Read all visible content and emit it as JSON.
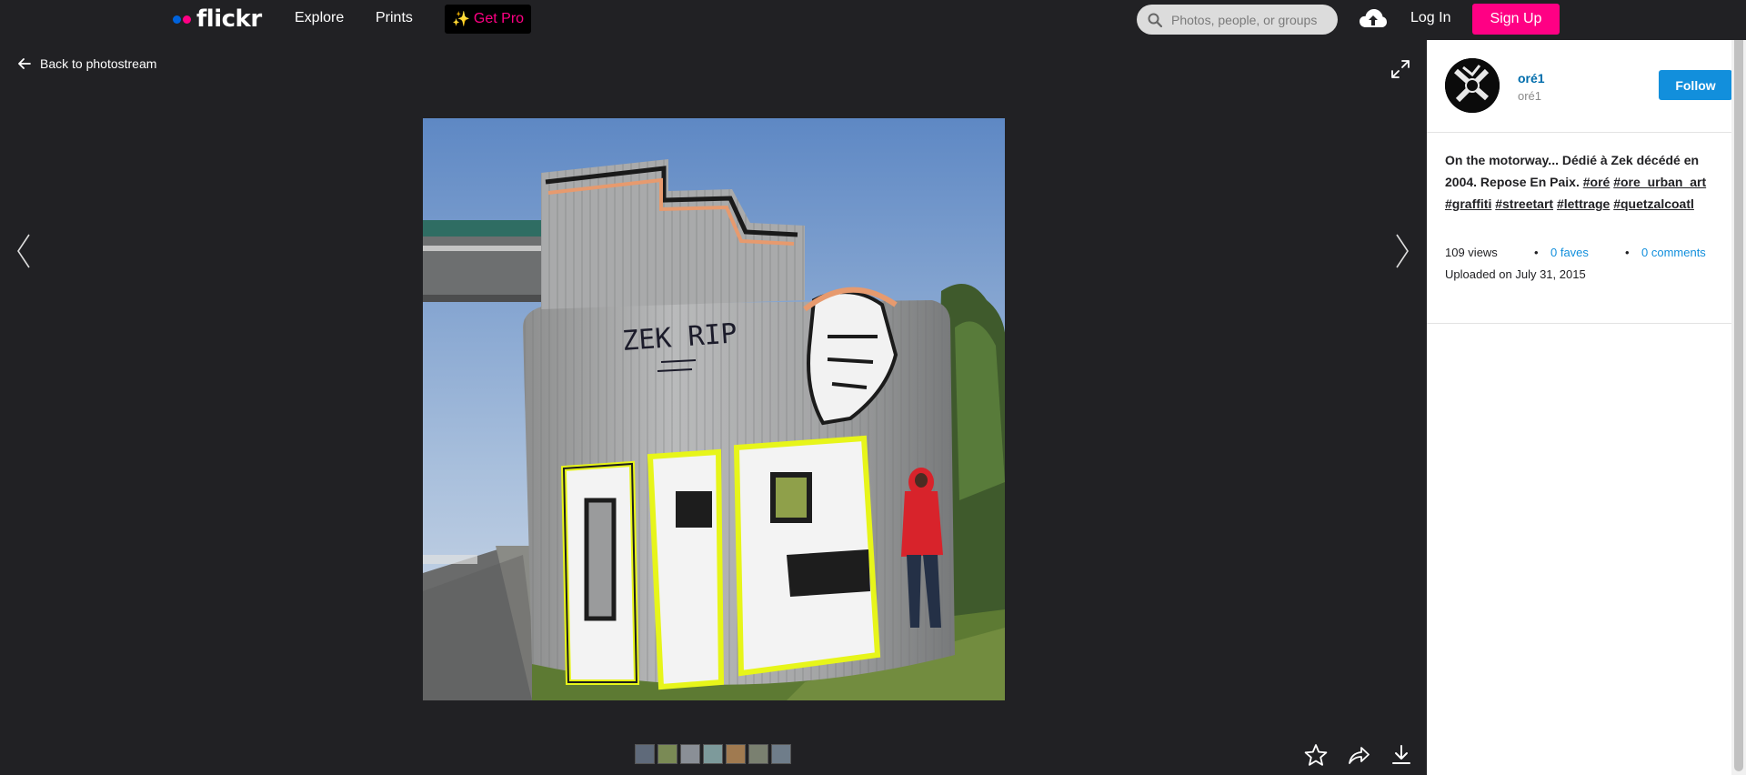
{
  "nav": {
    "logo_text": "flickr",
    "explore": "Explore",
    "prints": "Prints",
    "get_pro": "Get Pro",
    "get_pro_spark": "✨",
    "search_placeholder": "Photos, people, or groups",
    "login": "Log In",
    "signup": "Sign Up"
  },
  "viewer": {
    "back_label": "Back to photostream",
    "thumbnail_count": 7
  },
  "sidebar": {
    "owner_name": "oré1",
    "owner_sub": "oré1",
    "follow_label": "Follow",
    "description_text": "On the motorway... Dédié à Zek décédé en 2004. Repose En Paix.",
    "tags": [
      "#oré",
      "#ore_urban_art",
      "#graffiti",
      "#streetart",
      "#lettrage",
      "#quetzalcoatl"
    ],
    "views": "109 views",
    "faves": "0 faves",
    "comments": "0 comments",
    "uploaded": "Uploaded on July 31, 2015"
  },
  "colors": {
    "brand_pink": "#ff0084",
    "brand_blue": "#0063dc",
    "follow_blue": "#128fdc",
    "dark_bg": "#212124"
  },
  "icons": {
    "search": "search-icon",
    "upload": "cloud-upload-icon",
    "back": "arrow-left-icon",
    "expand": "expand-icon",
    "prev": "chevron-left-icon",
    "next": "chevron-right-icon",
    "fave": "star-icon",
    "share": "share-icon",
    "download": "download-icon"
  }
}
